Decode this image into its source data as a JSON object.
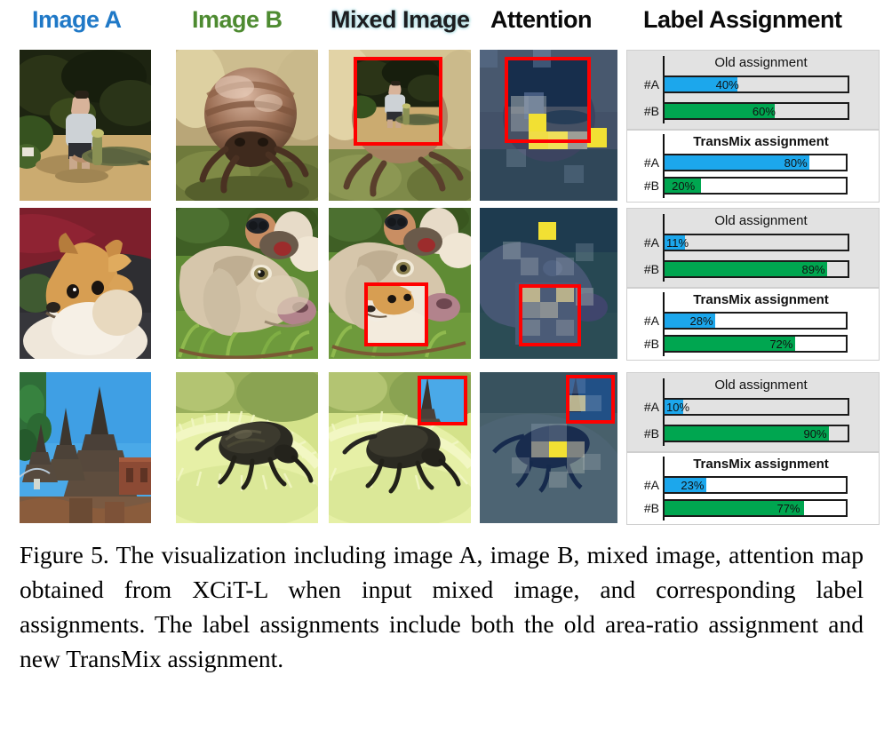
{
  "columns": [
    {
      "id": "image-a",
      "label": "Image A",
      "color": "#2079c7"
    },
    {
      "id": "image-b",
      "label": "Image B",
      "color": "#4e8b31"
    },
    {
      "id": "mixed-image",
      "label": "Mixed Image",
      "color": "#1d1d20"
    },
    {
      "id": "attention",
      "label": "Attention",
      "color": "#0a0a0a"
    },
    {
      "id": "label-assignment",
      "label": "Label Assignment",
      "color": "#0a0a0a"
    }
  ],
  "palette": {
    "class_a": "#1ca7ec",
    "class_b": "#00a650",
    "crop_box": "#ff0000",
    "old_panel_bg": "#e2e2e2",
    "new_panel_bg": "#ffffff",
    "attention_low": "#122e60",
    "attention_high": "#f2e033"
  },
  "panel_titles": {
    "old": "Old  assignment",
    "transmix": "TransMix assignment"
  },
  "bar_labels": {
    "a": "#A",
    "b": "#B"
  },
  "rows": [
    {
      "id": "row-1",
      "image_a_alt": "man crouching beside large lizard on sand",
      "image_b_alt": "close-up of a pillbug woodlouse on moss",
      "mixed_alt": "pillbug photo with lizard photo patch pasted in center",
      "attention_alt": "attention heat map over mixed image",
      "old": {
        "title": "Old  assignment",
        "bars": [
          {
            "label": "#A",
            "value": 40,
            "value_text": "40%",
            "class": "a"
          },
          {
            "label": "#B",
            "value": 60,
            "value_text": "60%",
            "class": "b"
          }
        ]
      },
      "transmix": {
        "title": "TransMix assignment",
        "bars": [
          {
            "label": "#A",
            "value": 80,
            "value_text": "80%",
            "class": "a"
          },
          {
            "label": "#B",
            "value": 20,
            "value_text": "20%",
            "class": "b"
          }
        ]
      }
    },
    {
      "id": "row-2",
      "image_a_alt": "fluffy pomeranian dog on red cushion",
      "image_b_alt": "pale brown dog lying in grass",
      "mixed_alt": "grass dog photo with pomeranian patch pasted in lower left",
      "attention_alt": "attention heat map over mixed image",
      "old": {
        "title": "Old  assignment",
        "bars": [
          {
            "label": "#A",
            "value": 11,
            "value_text": "11%",
            "class": "a"
          },
          {
            "label": "#B",
            "value": 89,
            "value_text": "89%",
            "class": "b"
          }
        ]
      },
      "transmix": {
        "title": "TransMix assignment",
        "bars": [
          {
            "label": "#A",
            "value": 28,
            "value_text": "28%",
            "class": "a"
          },
          {
            "label": "#B",
            "value": 72,
            "value_text": "72%",
            "class": "b"
          }
        ]
      }
    },
    {
      "id": "row-3",
      "image_a_alt": "ancient temple spires against blue sky",
      "image_b_alt": "black weevil beetle on fuzzy green leaf",
      "mixed_alt": "beetle photo with temple sky patch pasted in top right",
      "attention_alt": "attention heat map over mixed image",
      "old": {
        "title": "Old  assignment",
        "bars": [
          {
            "label": "#A",
            "value": 10,
            "value_text": "10%",
            "class": "a"
          },
          {
            "label": "#B",
            "value": 90,
            "value_text": "90%",
            "class": "b"
          }
        ]
      },
      "transmix": {
        "title": "TransMix assignment",
        "bars": [
          {
            "label": "#A",
            "value": 23,
            "value_text": "23%",
            "class": "a"
          },
          {
            "label": "#B",
            "value": 77,
            "value_text": "77%",
            "class": "b"
          }
        ]
      }
    }
  ],
  "caption": "Figure 5. The visualization including image A, image B, mixed image, attention map obtained from XCiT-L when input mixed image, and corresponding label assignments. The label assignments include both the old area-ratio assignment and new TransMix assignment."
}
